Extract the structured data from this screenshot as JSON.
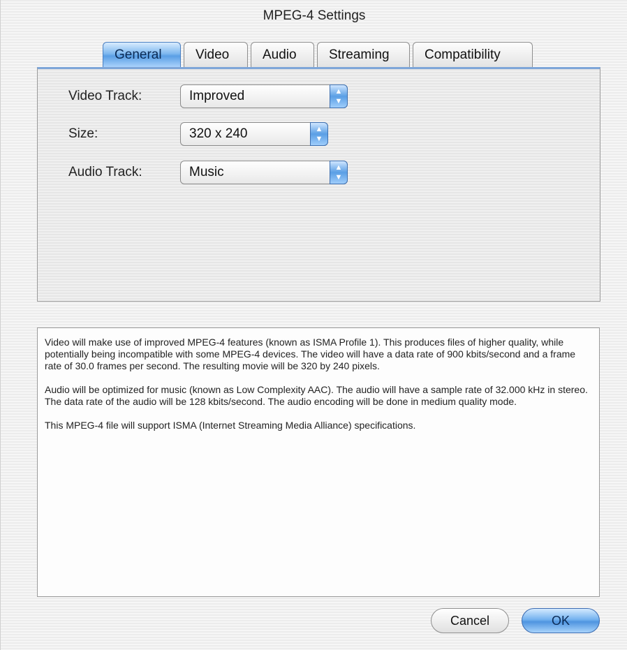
{
  "window": {
    "title": "MPEG-4 Settings"
  },
  "tabs": [
    {
      "label": "General",
      "active": true
    },
    {
      "label": "Video",
      "active": false
    },
    {
      "label": "Audio",
      "active": false
    },
    {
      "label": "Streaming",
      "active": false
    },
    {
      "label": "Compatibility",
      "active": false
    }
  ],
  "general": {
    "video_track": {
      "label": "Video Track:",
      "value": "Improved"
    },
    "size": {
      "label": "Size:",
      "value": "320 x 240"
    },
    "audio_track": {
      "label": "Audio Track:",
      "value": "Music"
    }
  },
  "description": {
    "paragraphs": [
      "Video will make use of improved MPEG-4 features (known as ISMA Profile 1).  This produces files of higher quality, while potentially being incompatible with some MPEG-4 devices.  The video will have a data rate of 900 kbits/second and a frame rate of 30.0 frames per second.  The resulting movie will be 320 by 240 pixels.",
      "Audio will be optimized for music (known as Low Complexity AAC).  The audio will have a sample rate of 32.000 kHz in stereo.  The data rate of the audio will be 128 kbits/second.  The audio encoding will be done in medium quality mode.",
      "This MPEG-4 file will support ISMA (Internet Streaming Media Alliance) specifications."
    ]
  },
  "buttons": {
    "cancel": "Cancel",
    "ok": "OK"
  },
  "colors": {
    "accent": "#5a9fe5",
    "panel_border": "#7ea6d8"
  }
}
